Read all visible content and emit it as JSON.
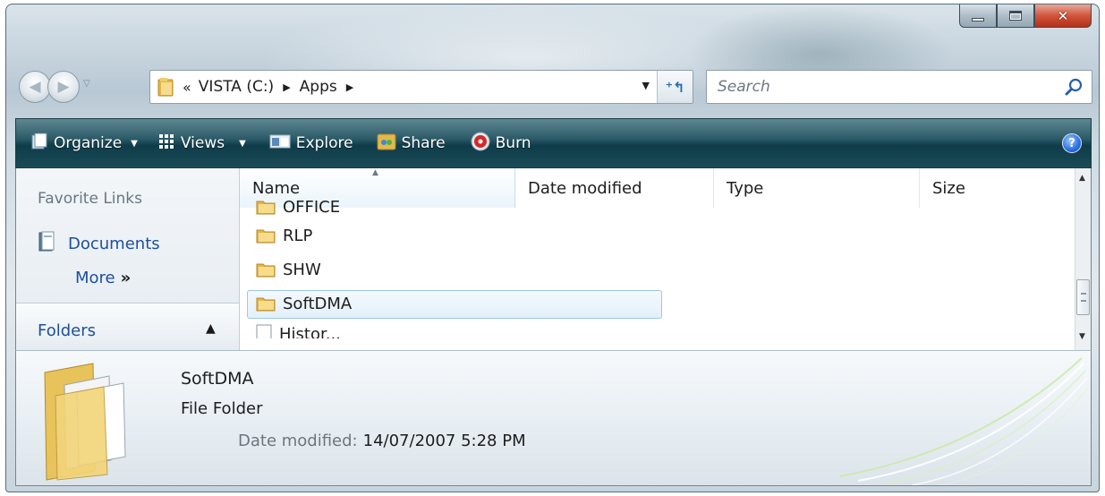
{
  "window": {
    "controls": {
      "minimize": "minimize-icon",
      "maximize": "maximize-icon",
      "close": "close-icon"
    }
  },
  "nav": {
    "back_icon": "back-arrow-icon",
    "forward_icon": "forward-arrow-icon"
  },
  "address": {
    "overflow": "«",
    "crumbs": [
      "VISTA (C:)",
      "Apps"
    ],
    "refresh_icon": "refresh-icon"
  },
  "search": {
    "placeholder": "Search"
  },
  "toolbar": {
    "organize": "Organize",
    "views": "Views",
    "explore": "Explore",
    "share": "Share",
    "burn": "Burn",
    "help": "?"
  },
  "nav_pane": {
    "favorite_links_header": "Favorite Links",
    "documents": "Documents",
    "more": "More",
    "more_chevron": "»",
    "folders": "Folders"
  },
  "columns": [
    "Name",
    "Date modified",
    "Type",
    "Size"
  ],
  "files": [
    {
      "name": "OFFICE",
      "kind": "folder"
    },
    {
      "name": "RLP",
      "kind": "folder"
    },
    {
      "name": "SHW",
      "kind": "folder"
    },
    {
      "name": "SoftDMA",
      "kind": "folder",
      "selected": true
    },
    {
      "name": "Histor...",
      "kind": "file"
    }
  ],
  "details": {
    "name": "SoftDMA",
    "type": "File Folder",
    "date_label": "Date modified:",
    "date_value": "14/07/2007 5:28 PM"
  },
  "colors": {
    "toolbar_dark": "#0f3c4a",
    "link_blue": "#1e4f9c",
    "selection_border": "#9fc7e6",
    "close_red": "#d0553d"
  }
}
